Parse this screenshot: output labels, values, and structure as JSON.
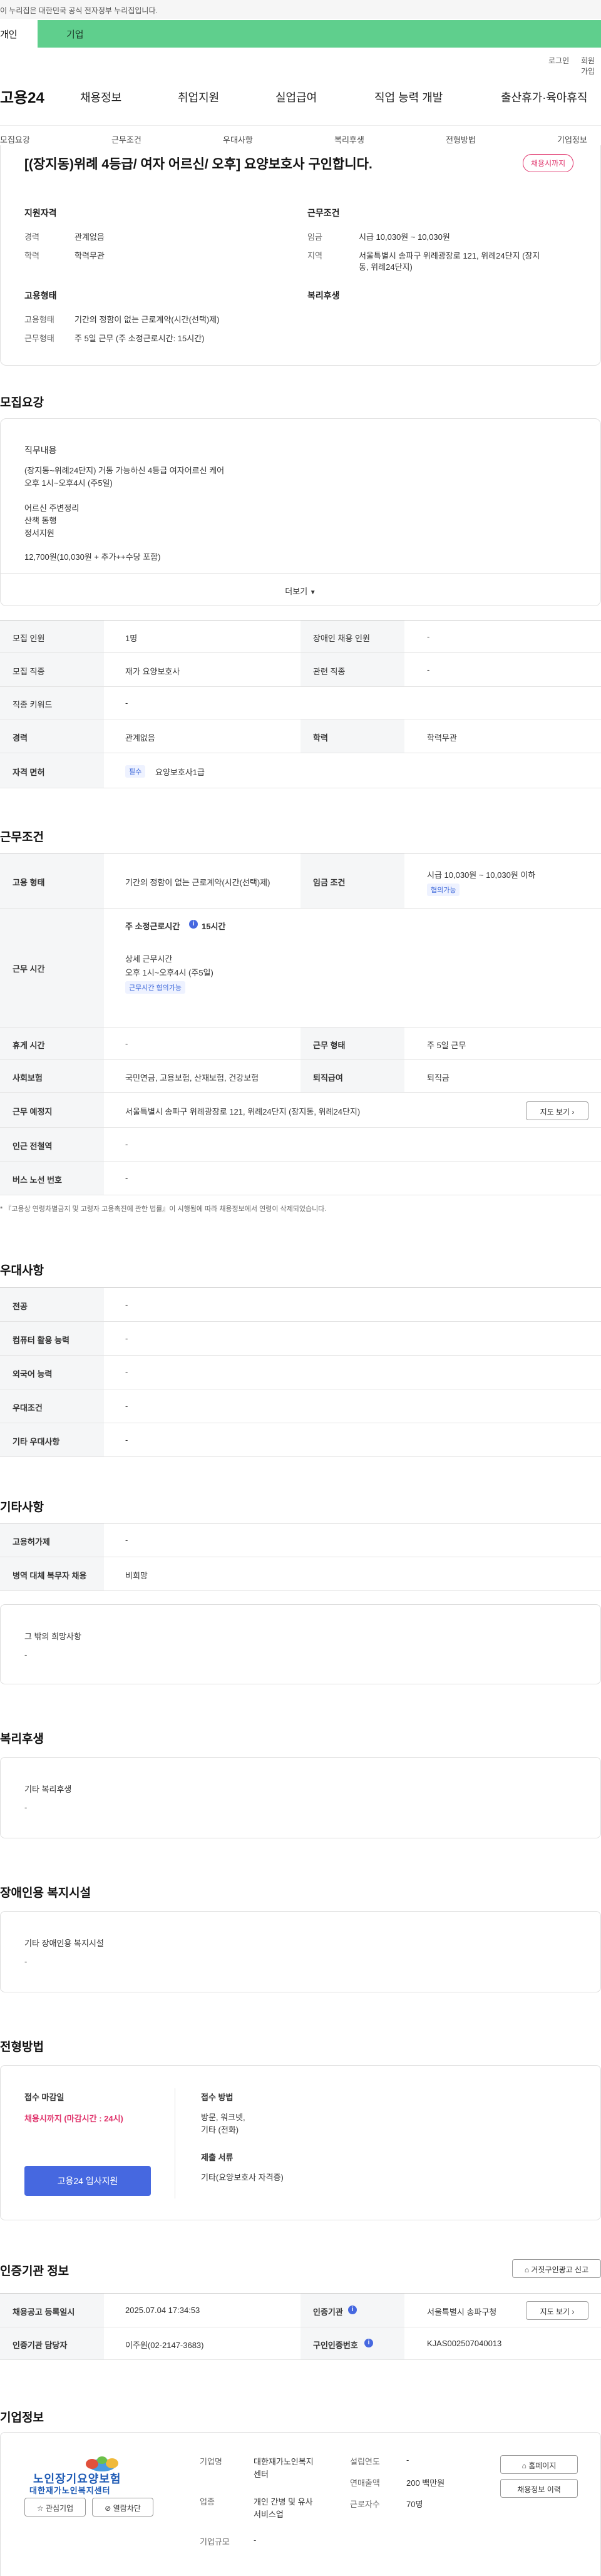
{
  "gov_banner": "이 누리집은 대한민국 공식 전자정부 누리집입니다.",
  "user_tabs": {
    "personal": "개인",
    "company": "기업"
  },
  "util_links": {
    "login": "로그인",
    "signup": "회원가입"
  },
  "logo": "고용24",
  "main_nav": [
    "채용정보",
    "취업지원",
    "실업급여",
    "직업 능력 개발",
    "출산휴가·육아휴직"
  ],
  "sub_nav": [
    "모집요강",
    "근무조건",
    "우대사항",
    "복리후생",
    "전형방법",
    "기업정보"
  ],
  "job_title": "[(장지동)위례 4등급/ 여자 어르신/ 오후] 요양보호사 구인합니다.",
  "recruit_status": "채용시까지",
  "summary": {
    "qual_title": "지원자격",
    "career_label": "경력",
    "career_value": "관계없음",
    "edu_label": "학력",
    "edu_value": "학력무관",
    "cond_title": "근무조건",
    "wage_label": "임금",
    "wage_value": "시급 10,030원 ~ 10,030원",
    "region_label": "지역",
    "region_value_1": "서울특별시 송파구 위례광장로 121, 위례24단지 (장지",
    "region_value_2": "동, 위례24단지)",
    "emp_title": "고용형태",
    "emp_type_label": "고용형태",
    "emp_type_value": "기간의 정함이 없는 근로계약(시간(선택)제)",
    "work_label": "근무형태",
    "work_value": "주 5일 근무 (주 소정근로시간: 15시간)",
    "welfare_title": "복리후생"
  },
  "recruit": {
    "section_title": "모집요강",
    "duty_title": "직무내용",
    "duty_lines": [
      "(장지동~위례24단지) 거동 가능하신 4등급 여자어르신 케어",
      "오후 1시~오후4시 (주5일)",
      "",
      "어르신 주변정리",
      "산책 동행",
      "정서지원",
      "",
      "12,700원(10,030원 + 추가++수당 포함)"
    ],
    "more_button": "더보기",
    "rows": [
      {
        "k1": "모집 인원",
        "v1": "1명",
        "k2": "장애인 채용 인원",
        "v2": "-"
      },
      {
        "k1": "모집 직종",
        "v1": "재가 요양보호사",
        "k2": "관련 직종",
        "v2": "-"
      },
      {
        "k1": "직종 키워드",
        "v1": "-"
      },
      {
        "k1": "경력",
        "v1": "관계없음",
        "k2": "학력",
        "v2": "학력무관"
      },
      {
        "k1": "자격 면허",
        "v1": "요양보호사1급",
        "chip": "필수"
      }
    ]
  },
  "conditions": {
    "section_title": "근무조건",
    "emp_type_k": "고용 형태",
    "emp_type_v": "기간의 정함이 없는 근로계약(시간(선택)제)",
    "wage_k": "임금 조건",
    "wage_v": "시급 10,030원 ~ 10,030원 이하",
    "wage_chip": "협의가능",
    "hours_k": "근무 시간",
    "hours_weekly": "주 소정근로시간",
    "hours_weekly_v": "15시간",
    "hours_detail_title": "상세 근무시간",
    "hours_detail_v": "오후 1시~오후4시 (주5일)",
    "hours_chip": "근무시간 협의가능",
    "rest_k": "휴게 시간",
    "rest_v": "-",
    "work_form_k": "근무 형태",
    "work_form_v": "주 5일 근무",
    "insurance_k": "사회보험",
    "insurance_v": "국민연금, 고용보험, 산재보험, 건강보험",
    "retire_k": "퇴직급여",
    "retire_v": "퇴직금",
    "place_k": "근무 예정지",
    "place_v": "서울특별시 송파구 위례광장로 121, 위례24단지 (장지동, 위례24단지)",
    "map_button": "지도 보기",
    "station_k": "인근 전철역",
    "station_v": "-",
    "bus_k": "버스 노선 번호",
    "bus_v": "-",
    "note": "* 『고용상 연령차별금지 및 고령자 고용촉진에 관한 법률』이 시행됨에 따라 채용정보에서 연령이 삭제되었습니다."
  },
  "preference": {
    "section_title": "우대사항",
    "rows": [
      {
        "k": "전공",
        "v": "-"
      },
      {
        "k": "컴퓨터 활용 능력",
        "v": "-"
      },
      {
        "k": "외국어 능력",
        "v": "-"
      },
      {
        "k": "우대조건",
        "v": "-"
      },
      {
        "k": "기타 우대사항",
        "v": "-"
      }
    ]
  },
  "etc": {
    "section_title": "기타사항",
    "rows": [
      {
        "k": "고용허가제",
        "v": "-"
      },
      {
        "k": "병역 대체 복무자 채용",
        "v": "비희망"
      }
    ],
    "other_title": "그 밖의 희망사항",
    "other_v": "-"
  },
  "welfare": {
    "section_title": "복리후생",
    "box_title": "기타 복리후생",
    "box_v": "-"
  },
  "disabled": {
    "section_title": "장애인용 복지시설",
    "box_title": "기타 장애인용 복지시설",
    "box_v": "-"
  },
  "screening": {
    "section_title": "전형방법",
    "deadline_title": "접수 마감일",
    "deadline_v": "채용시까지 (마감시간 : 24시)",
    "apply_button": "고용24 입사지원",
    "method_title": "접수 방법",
    "method_v1": "방문, 워크넷,",
    "method_v2": "기타 (전화)",
    "docs_title": "제출 서류",
    "docs_v": "기타(요양보호사 자격증)"
  },
  "cert": {
    "section_title": "인증기관 정보",
    "report_button": "거짓구인광고 신고",
    "reg_k": "채용공고 등록일시",
    "reg_v": "2025.07.04 17:34:53",
    "agency_k": "인증기관",
    "agency_v": "서울특별시 송파구청",
    "map_button": "지도 보기",
    "manager_k": "인증기관 담당자",
    "manager_v": "이주원(02-2147-3683)",
    "cert_no_k": "구인인증번호",
    "cert_no_v": "KJAS002507040013"
  },
  "company": {
    "section_title": "기업정보",
    "logo_text_1": "노인장기요양보험",
    "logo_text_2": "대한재가노인복지센터",
    "fav_button": "관심기업",
    "block_button": "열람차단",
    "name_k": "기업명",
    "name_v1": "대한재가노인복지",
    "name_v2": "센터",
    "industry_k": "업종",
    "industry_v1": "개인 간병 및 유사",
    "industry_v2": "서비스업",
    "size_k": "기업규모",
    "size_v": "-",
    "founded_k": "설립연도",
    "founded_v": "-",
    "sales_k": "연매출액",
    "sales_v": "200 백만원",
    "staff_k": "근로자수",
    "staff_v": "70명",
    "home_button": "홈페이지",
    "jobs_button": "채용정보 이력"
  },
  "colors": {
    "accent_green": "#5fcf8d",
    "accent_blue": "#4668e0",
    "alert_red": "#e0336b"
  }
}
